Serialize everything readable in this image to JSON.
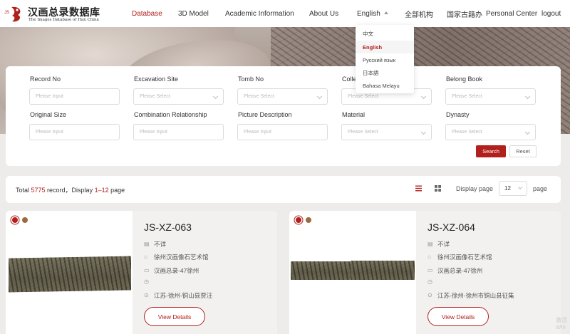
{
  "header": {
    "logo_cn": "汉画总录数据库",
    "logo_en": "The Images Database of Han China",
    "logo_mark": "JS",
    "nav": [
      "Database",
      "3D Model",
      "Academic Information",
      "About Us",
      "English",
      "全部机构",
      "国家古籍办",
      "Personal Center",
      "logout"
    ]
  },
  "language_menu": {
    "items": [
      "中文",
      "English",
      "Русский язык",
      "日本語",
      "Bahasa Melayu"
    ],
    "selected": "English"
  },
  "search": {
    "labels": [
      "Record No",
      "Excavation Site",
      "Tomb No",
      "Collection",
      "Belong Book",
      "Original Size",
      "Combination Relationship",
      "Picture Description",
      "Material",
      "Dynasty"
    ],
    "placeholders": [
      "Please Input",
      "Please Select",
      "Please Select",
      "Please Select",
      "Please Select",
      "Please Input",
      "Please Input",
      "Please Input",
      "Please Select",
      "Please Select"
    ],
    "search_label": "Search",
    "reset_label": "Reset"
  },
  "results": {
    "total_prefix": "Total ",
    "total": "5775",
    "mid": " record，Display ",
    "range": "1–12",
    "suffix": " page",
    "display_page_label": "Display page",
    "page_size": "12",
    "page_label": "page"
  },
  "cards": [
    {
      "id": "JS-XZ-063",
      "size": "不详",
      "museum": "徐州汉画像石艺术馆",
      "book": "汉画总录-47徐州",
      "extra": "",
      "location": "江苏-徐州-铜山县贾汪",
      "button": "View Details"
    },
    {
      "id": "JS-XZ-064",
      "size": "不详",
      "museum": "徐州汉画像石艺术馆",
      "book": "汉画总录-47徐州",
      "extra": "",
      "location": "江苏-徐州-徐州市铜山县征集",
      "button": "View Details"
    }
  ],
  "watermark": "激活 Win",
  "colors": {
    "accent": "#b0201c",
    "tag_brown": "#9a6b3f"
  },
  "icons": [
    "ruler-icon",
    "museum-icon",
    "book-icon",
    "clock-icon",
    "location-pin-icon",
    "list-view-icon",
    "grid-view-icon",
    "chevron-down-icon"
  ]
}
